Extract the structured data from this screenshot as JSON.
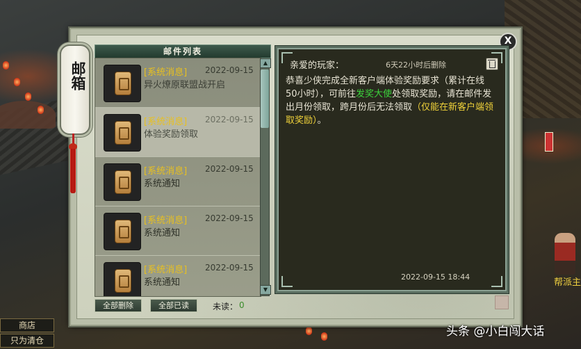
{
  "mailbox": {
    "title": "邮箱",
    "close_glyph": "X",
    "list_header": "邮件列表",
    "unread_label": "未读：",
    "unread_count": "0",
    "buttons": {
      "delete_all": "全部删除",
      "read_all": "全部已读"
    },
    "mails": [
      {
        "tag": "[系统消息]",
        "date": "2022-09-15",
        "subject": "异火燎原联盟战开启"
      },
      {
        "tag": "[系统消息]",
        "date": "2022-09-15",
        "subject": "体验奖励领取"
      },
      {
        "tag": "[系统消息]",
        "date": "2022-09-15",
        "subject": "系统通知"
      },
      {
        "tag": "[系统消息]",
        "date": "2022-09-15",
        "subject": "系统通知"
      },
      {
        "tag": "[系统消息]",
        "date": "2022-09-15",
        "subject": "系统通知"
      }
    ],
    "selected_index": 1,
    "detail": {
      "greeting": "亲爱的玩家：",
      "expire": "6天22小时后删除",
      "body_part1": "    恭喜少侠完成全新客户端体验奖励要求（累计在线50小时），可前往",
      "body_link": "发奖大使",
      "body_part2": "处领取奖励，请在邮件发出月份领取，跨月份后无法领取",
      "body_note": "（仅能在新客户端领取奖励）",
      "body_end": "。",
      "time": "2022-09-15  18:44"
    }
  },
  "game_ui": {
    "menu": [
      "商店",
      "只为清仓"
    ],
    "npc_label": "帮派主"
  },
  "watermark": "头条 @小白闯大话",
  "colors": {
    "tag_yellow": "#e8c020",
    "link_green": "#3cd23c",
    "note_yellow": "#f0d23a",
    "detail_bg": "#292a1e"
  }
}
